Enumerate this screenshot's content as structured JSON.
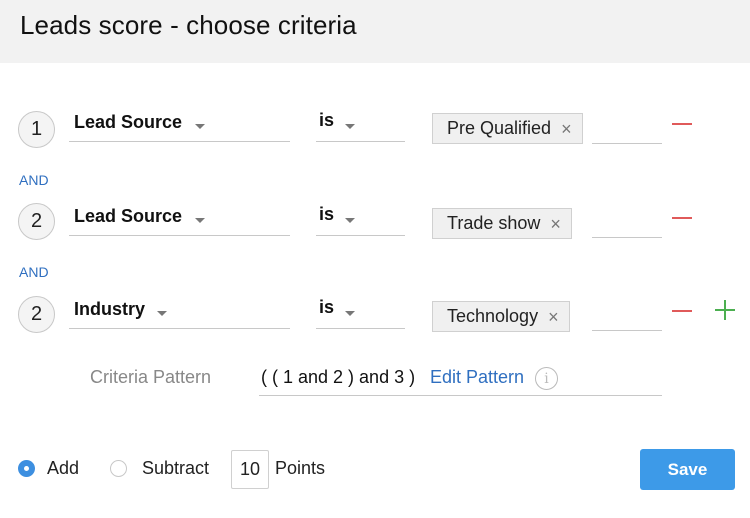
{
  "header": {
    "title": "Leads score - choose criteria"
  },
  "criteria": [
    {
      "number": "1",
      "field": "Lead Source",
      "operator": "is",
      "value_chip": "Pre Qualified",
      "remove_icon": "minus-icon"
    },
    {
      "number": "2",
      "field": "Lead Source",
      "operator": "is",
      "value_chip": "Trade show",
      "remove_icon": "minus-icon"
    },
    {
      "number": "2",
      "field": "Industry",
      "operator": "is",
      "value_chip": "Technology",
      "remove_icon": "minus-icon",
      "add_icon": "plus-icon"
    }
  ],
  "connectors": [
    "AND",
    "AND"
  ],
  "chip_remove_glyph": "×",
  "pattern": {
    "label": "Criteria Pattern",
    "value": "( ( 1 and 2 ) and 3 )",
    "edit_label": "Edit Pattern",
    "info_glyph": "i"
  },
  "footer": {
    "add_label": "Add",
    "subtract_label": "Subtract",
    "selected": "Add",
    "points_value": "10",
    "points_label": "Points",
    "save_label": "Save"
  },
  "colors": {
    "accent": "#3d9ae8",
    "link": "#2f6fc0",
    "remove": "#e05a5a",
    "add": "#4caf50"
  }
}
